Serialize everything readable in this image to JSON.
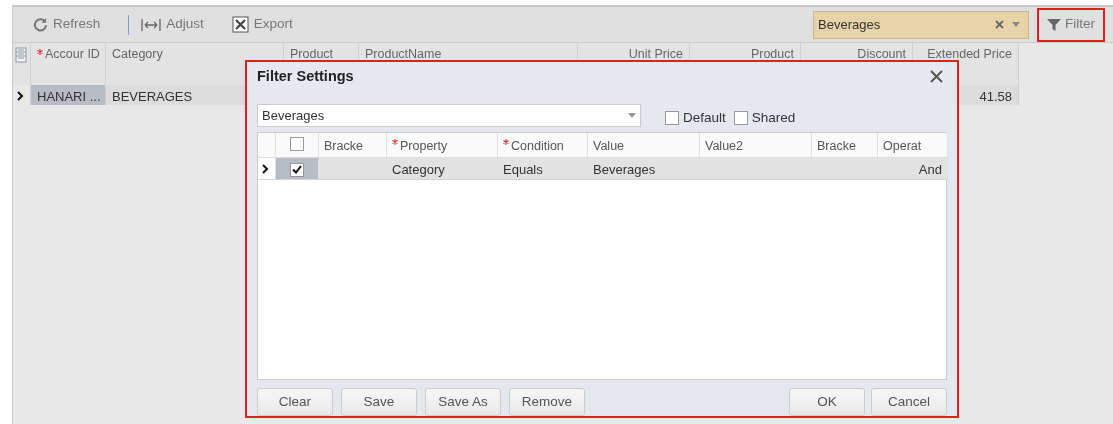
{
  "toolbar": {
    "buttons": [
      {
        "kind": "refresh",
        "label": "Refresh"
      },
      {
        "kind": "adjust",
        "label": "Adjust"
      },
      {
        "kind": "export",
        "label": "Export"
      }
    ],
    "filter_select": {
      "value": "Beverages"
    },
    "filter_button": {
      "label": "Filter",
      "highlighted": true
    }
  },
  "grid": {
    "columns": [
      {
        "label": "Accour ID",
        "required": true
      },
      {
        "label": "Category",
        "required": false
      },
      {
        "label": "Product",
        "required": false
      },
      {
        "label": "ProductName",
        "required": false
      },
      {
        "label": "Unit Price",
        "required": false
      },
      {
        "label": "Product",
        "required": false
      },
      {
        "label": "Discount",
        "required": false
      },
      {
        "label": "Extended Price",
        "required": false
      }
    ],
    "rows": [
      {
        "selected": true,
        "cells": [
          "HANARI ...",
          "BEVERAGES",
          "",
          "",
          "",
          "",
          "",
          "41.58"
        ]
      }
    ]
  },
  "dialog": {
    "title": "Filter Settings",
    "filter_name": "Beverages",
    "default": false,
    "shared": false,
    "default_label": "Default",
    "shared_label": "Shared",
    "all_checked": false,
    "columns": [
      {
        "label": "Bracke",
        "required": false
      },
      {
        "label": "Property",
        "required": true
      },
      {
        "label": "Condition",
        "required": true
      },
      {
        "label": "Value",
        "required": false
      },
      {
        "label": "Value2",
        "required": false
      },
      {
        "label": "Bracke",
        "required": false
      },
      {
        "label": "Operat",
        "required": false
      }
    ],
    "rows": [
      {
        "selected": true,
        "checked": true,
        "cells": [
          "",
          "Category",
          "Equals",
          "Beverages",
          "",
          "",
          "And"
        ]
      }
    ],
    "left_buttons": [
      "Clear",
      "Save",
      "Save As",
      "Remove"
    ],
    "right_buttons": [
      "OK",
      "Cancel"
    ]
  }
}
